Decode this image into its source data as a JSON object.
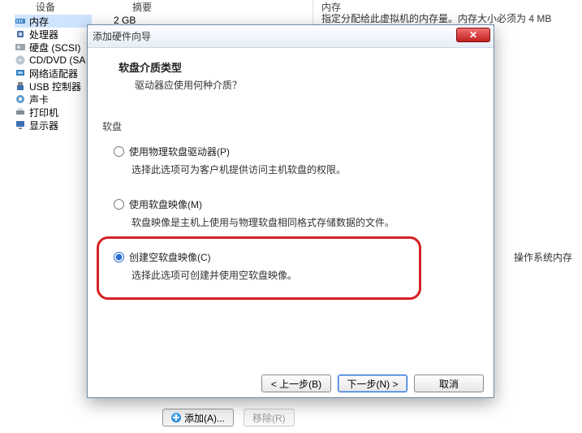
{
  "bg": {
    "col_device": "设备",
    "col_summary": "摘要",
    "devices": [
      {
        "label": "内存"
      },
      {
        "label": "处理器"
      },
      {
        "label": "硬盘 (SCSI)"
      },
      {
        "label": "CD/DVD (SA"
      },
      {
        "label": "网络适配器"
      },
      {
        "label": "USB 控制器"
      },
      {
        "label": "声卡"
      },
      {
        "label": "打印机"
      },
      {
        "label": "显示器"
      }
    ],
    "summary_value": "2 GB",
    "right_title": "内存",
    "right_desc": "指定分配给此虚拟机的内存量。内存大小必须为 4 MB",
    "os_note": "操作系统内存",
    "add_btn": "添加(A)...",
    "remove_btn": "移除(R)"
  },
  "dialog": {
    "title": "添加硬件向导",
    "header_title": "软盘介质类型",
    "header_sub": "驱动器应使用何种介质？",
    "group_label": "软盘",
    "opt1_label": "使用物理软盘驱动器(P)",
    "opt1_desc": "选择此选项可为客户机提供访问主机软盘的权限。",
    "opt2_label": "使用软盘映像(M)",
    "opt2_desc": "软盘映像是主机上使用与物理软盘相同格式存储数据的文件。",
    "opt3_label": "创建空软盘映像(C)",
    "opt3_desc": "选择此选项可创建并使用空软盘映像。",
    "back_btn": "< 上一步(B)",
    "next_btn": "下一步(N) >",
    "cancel_btn": "取消",
    "close_x": "✕"
  }
}
